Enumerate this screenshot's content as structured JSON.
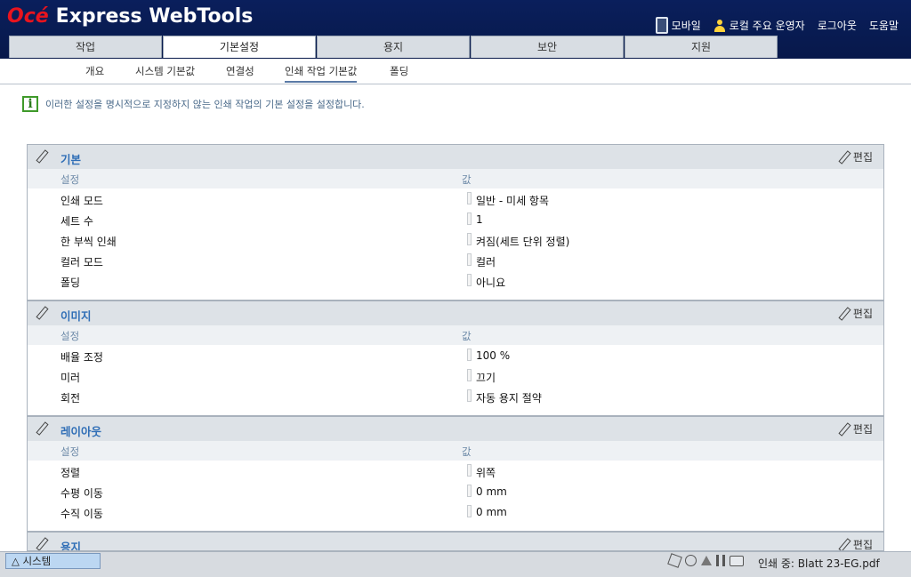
{
  "header": {
    "brand": "Océ",
    "product": "Express WebTools",
    "links": {
      "mobile": "모바일",
      "user": "로컬 주요 운영자",
      "logout": "로그아웃",
      "help": "도움말"
    }
  },
  "tabs": [
    "작업",
    "기본설정",
    "용지",
    "보안",
    "지원"
  ],
  "subtabs": [
    "개요",
    "시스템 기본값",
    "연결성",
    "인쇄 작업 기본값",
    "폴딩"
  ],
  "info_text": "이러한 설정을 명시적으로 지정하지 않는 인쇄 작업의 기본 설정을 설정합니다.",
  "columns": {
    "setting": "설정",
    "value": "값"
  },
  "edit_label": "편집",
  "sections": [
    {
      "title": "기본",
      "rows": [
        {
          "k": "인쇄 모드",
          "v": "일반 - 미세 항목"
        },
        {
          "k": "세트 수",
          "v": "1"
        },
        {
          "k": "한 부씩 인쇄",
          "v": "켜짐(세트 단위 정렬)"
        },
        {
          "k": "컬러 모드",
          "v": "컬러"
        },
        {
          "k": "폴딩",
          "v": "아니요"
        }
      ]
    },
    {
      "title": "이미지",
      "rows": [
        {
          "k": "배율 조정",
          "v": "100 %"
        },
        {
          "k": "미러",
          "v": "끄기"
        },
        {
          "k": "회전",
          "v": "자동 용지 절약"
        }
      ]
    },
    {
      "title": "레이아웃",
      "rows": [
        {
          "k": "정렬",
          "v": "위쪽"
        },
        {
          "k": "수평 이동",
          "v": "0 mm"
        },
        {
          "k": "수직 이동",
          "v": "0 mm"
        }
      ]
    },
    {
      "title": "용지",
      "rows": []
    }
  ],
  "statusbar": {
    "system_tab": "△ 시스템",
    "status": "인쇄 중: Blatt 23-EG.pdf"
  }
}
